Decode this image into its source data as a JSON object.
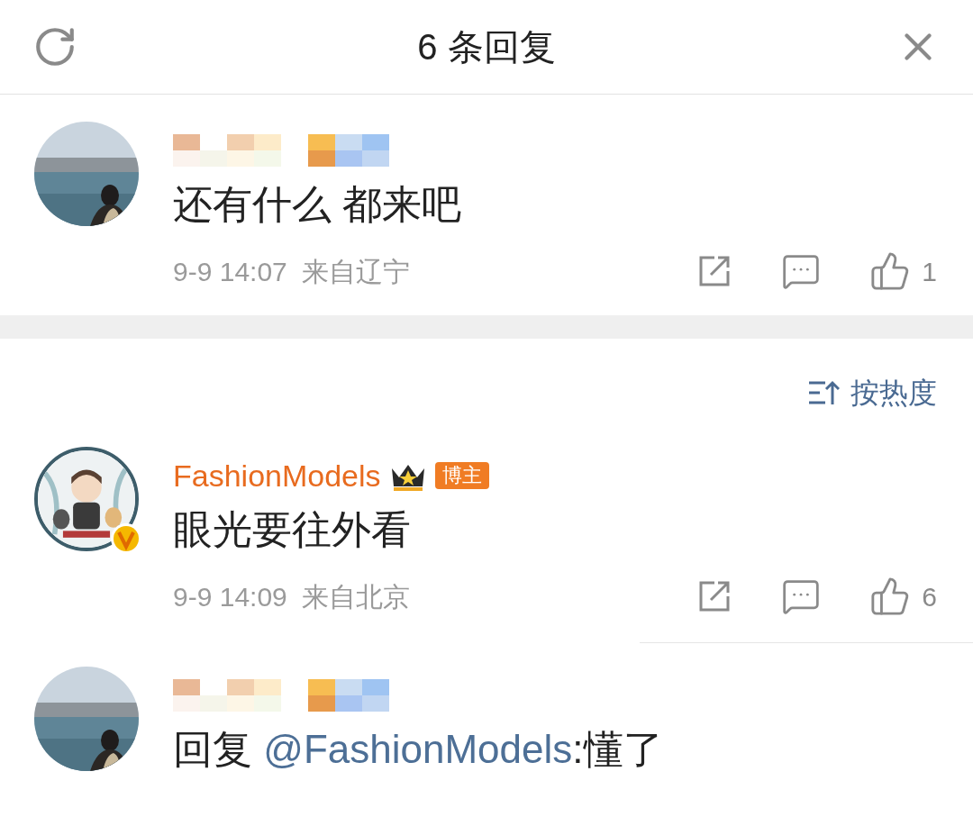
{
  "header": {
    "title": "6 条回复"
  },
  "root_comment": {
    "author": {
      "kind": "blurred"
    },
    "text": [
      {
        "kind": "text",
        "text": "还有什么 都来吧"
      }
    ],
    "meta": {
      "time": "9-9 14:07",
      "location": "来自辽宁",
      "likes": "1"
    }
  },
  "sort": {
    "label": "按热度"
  },
  "replies": [
    {
      "author": {
        "kind": "named",
        "name": "FashionModels",
        "crown": true,
        "badge": "博主"
      },
      "avatar": {
        "kind": "illustration",
        "verified": true
      },
      "text": [
        {
          "kind": "text",
          "text": "眼光要往外看"
        }
      ],
      "meta": {
        "time": "9-9 14:09",
        "location": "来自北京",
        "likes": "6"
      }
    },
    {
      "author": {
        "kind": "blurred"
      },
      "text": [
        {
          "kind": "text",
          "text": "回复 "
        },
        {
          "kind": "mention",
          "text": "@FashionModels"
        },
        {
          "kind": "text",
          "text": ":懂了"
        }
      ]
    }
  ]
}
